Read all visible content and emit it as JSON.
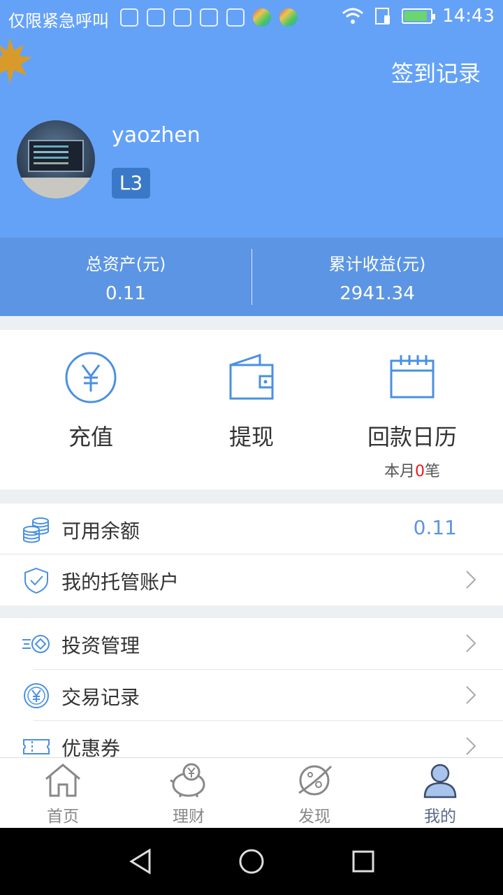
{
  "status_bar": {
    "carrier": "仅限紧急呼叫",
    "time": "14:43"
  },
  "header": {
    "signin_records": "签到记录",
    "username": "yaozhen",
    "level": "L3"
  },
  "stats": {
    "total_assets_label": "总资产(元)",
    "total_assets_value": "0.11",
    "cumulative_earnings_label": "累计收益(元)",
    "cumulative_earnings_value": "2941.34"
  },
  "actions": {
    "recharge": "充值",
    "withdraw": "提现",
    "repayment_calendar": "回款日历",
    "calendar_sub_prefix": "本月",
    "calendar_sub_count": "0",
    "calendar_sub_suffix": "笔"
  },
  "menu": {
    "available_balance": "可用余额",
    "available_balance_value": "0.11",
    "custody_account": "我的托管账户",
    "investment_management": "投资管理",
    "transaction_records": "交易记录",
    "coupons": "优惠券"
  },
  "tabs": {
    "home": "首页",
    "finance": "理财",
    "discover": "发现",
    "mine": "我的"
  },
  "colors": {
    "primary": "#64a2f8",
    "stats_bg": "#5c95e3",
    "icon_blue": "#4a90e2",
    "accent_red": "#e51c1c"
  },
  "icons": {
    "recharge": "yuan-circle-icon",
    "withdraw": "wallet-icon",
    "calendar": "calendar-icon"
  }
}
